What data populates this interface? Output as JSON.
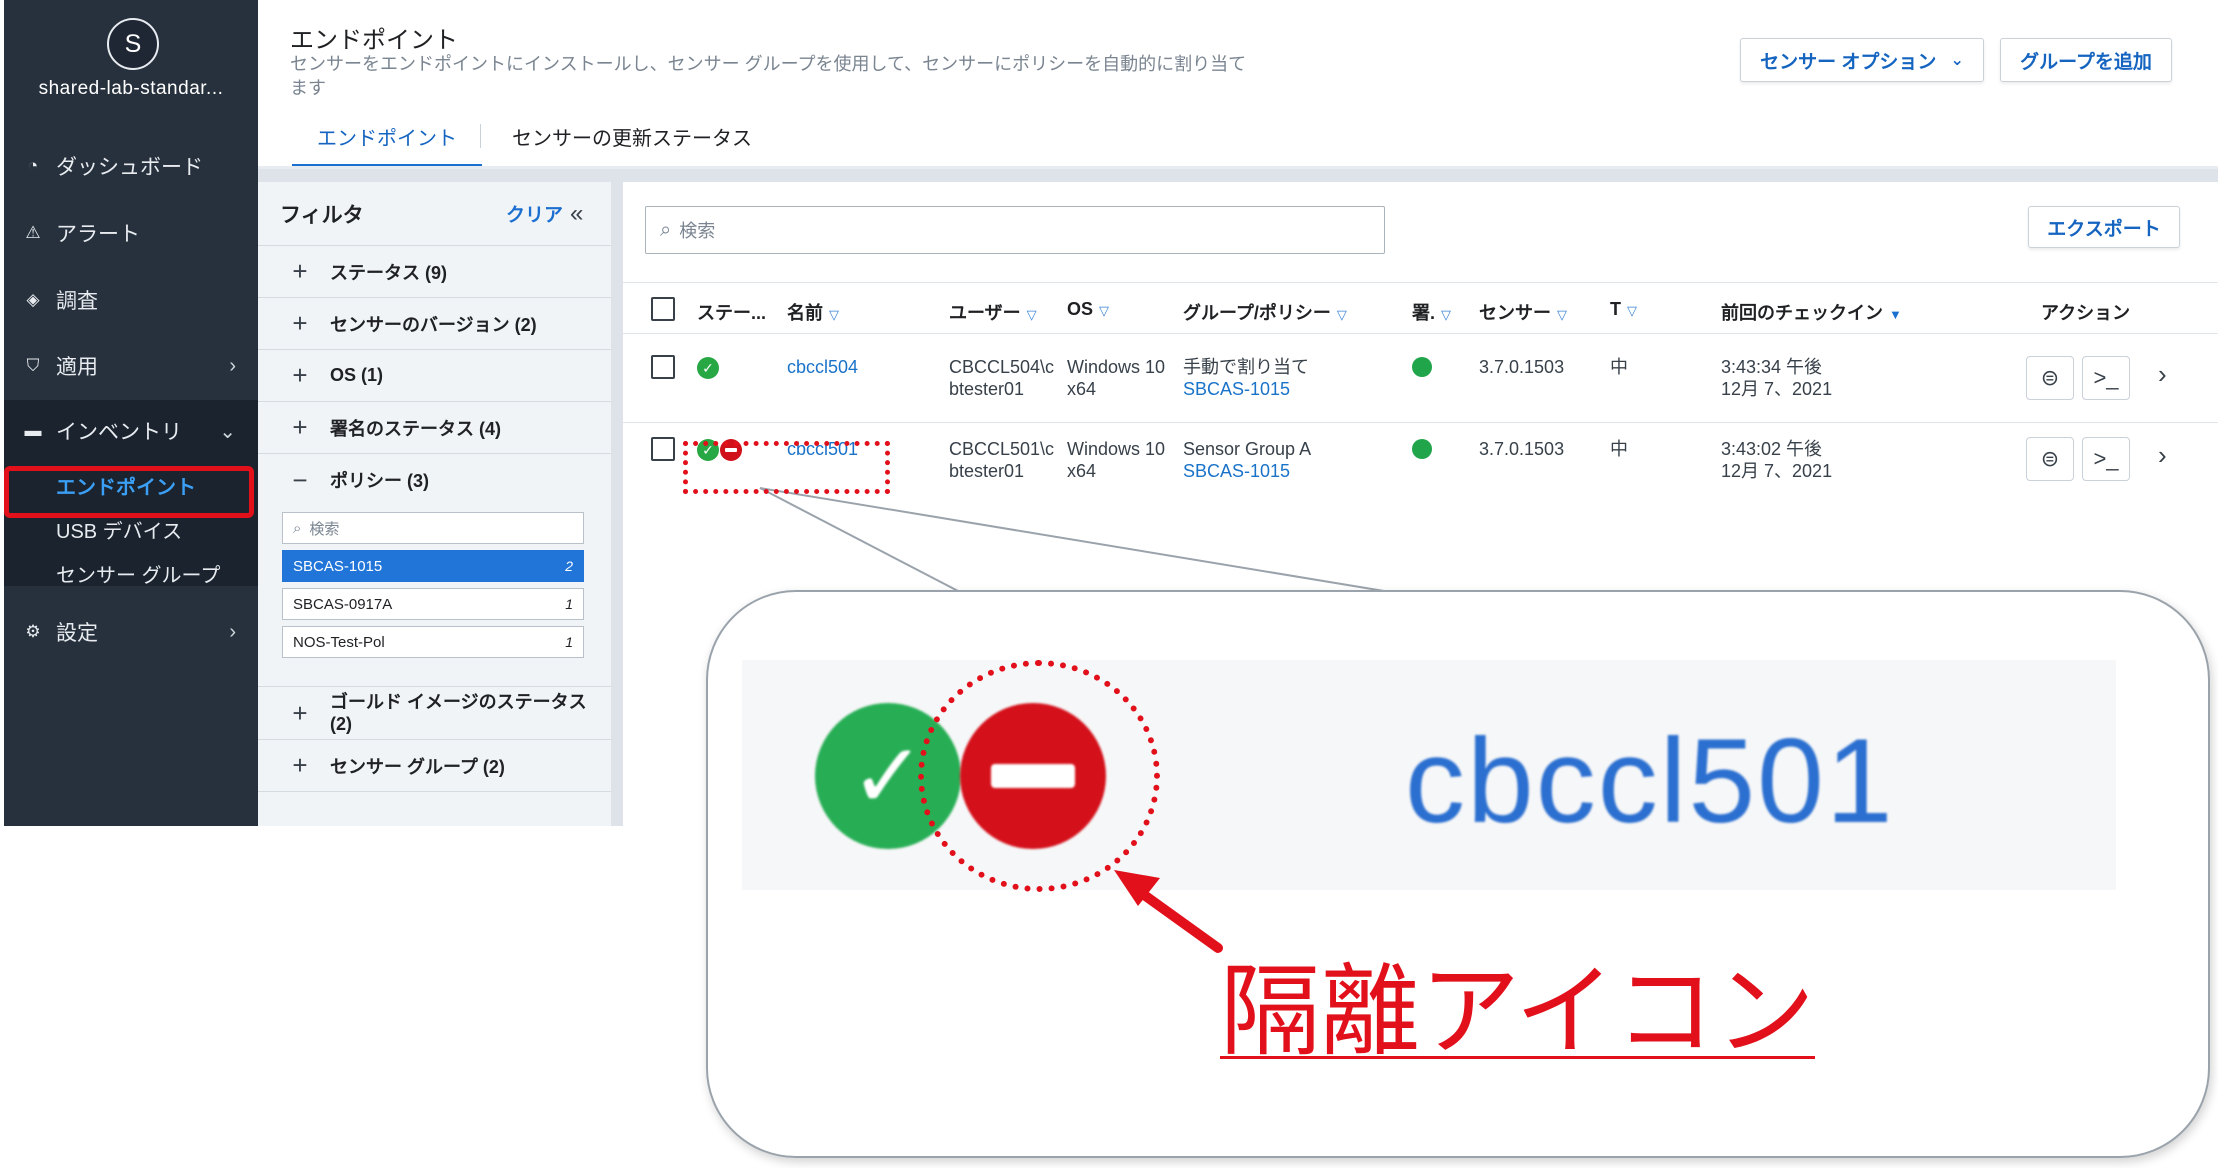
{
  "sidebar": {
    "avatar_initial": "S",
    "org_name": "shared-lab-standar...",
    "nav": [
      {
        "label": "ダッシュボード",
        "icon": "dashboard-icon"
      },
      {
        "label": "アラート",
        "icon": "alert-icon"
      },
      {
        "label": "調査",
        "icon": "investigate-icon"
      },
      {
        "label": "適用",
        "icon": "enforce-icon"
      },
      {
        "label": "インベントリ",
        "icon": "inventory-icon"
      },
      {
        "label": "設定",
        "icon": "settings-icon"
      }
    ],
    "inventory_sub": [
      "エンドポイント",
      "USB デバイス",
      "センサー グループ"
    ]
  },
  "header": {
    "title": "エンドポイント",
    "description": "センサーをエンドポイントにインストールし、センサー グループを使用して、センサーにポリシーを自動的に割り当てます",
    "sensor_options_label": "センサー オプション",
    "add_group_label": "グループを追加",
    "tabs": [
      "エンドポイント",
      "センサーの更新ステータス"
    ]
  },
  "filter": {
    "title": "フィルタ",
    "clear_label": "クリア",
    "sections": [
      {
        "label": "ステータス (9)",
        "sign": "+"
      },
      {
        "label": "センサーのバージョン (2)",
        "sign": "+"
      },
      {
        "label": "OS (1)",
        "sign": "+"
      },
      {
        "label": "署名のステータス (4)",
        "sign": "+"
      },
      {
        "label": "ポリシー (3)",
        "sign": "−"
      },
      {
        "label": "ゴールド イメージのステータス (2)",
        "sign": "+"
      },
      {
        "label": "センサー グループ (2)",
        "sign": "+"
      }
    ],
    "policy_search_placeholder": "検索",
    "policies": [
      {
        "name": "SBCAS-1015",
        "count": "2",
        "selected": true
      },
      {
        "name": "SBCAS-0917A",
        "count": "1",
        "selected": false
      },
      {
        "name": "NOS-Test-Pol",
        "count": "1",
        "selected": false
      }
    ]
  },
  "table": {
    "search_placeholder": "検索",
    "export_label": "エクスポート",
    "columns": [
      "ステー...",
      "名前",
      "ユーザー",
      "OS",
      "グループ/ポリシー",
      "署.",
      "センサー",
      "T",
      "前回のチェックイン",
      "アクション"
    ],
    "rows": [
      {
        "name": "cbccl504",
        "user1": "CBCCL504\\c",
        "user2": "btester01",
        "os1": "Windows 10",
        "os2": "x64",
        "group": "手動で割り当て",
        "policy": "SBCAS-1015",
        "sensor": "3.7.0.1503",
        "t": "中",
        "checkin1": "3:43:34 午後",
        "checkin2": "12月 7、2021",
        "quarantined": false
      },
      {
        "name": "cbccl501",
        "user1": "CBCCL501\\c",
        "user2": "btester01",
        "os1": "Windows 10",
        "os2": "x64",
        "group": "Sensor Group A",
        "policy": "SBCAS-1015",
        "sensor": "3.7.0.1503",
        "t": "中",
        "checkin1": "3:43:02 午後",
        "checkin2": "12月 7、2021",
        "quarantined": true
      }
    ]
  },
  "callout": {
    "zoom_name": "cbccl501",
    "label": "隔離アイコン"
  },
  "colors": {
    "accent": "#1a6fd0",
    "highlight": "#e2101b",
    "ok": "#28a745",
    "quarantine": "#d0101a"
  }
}
